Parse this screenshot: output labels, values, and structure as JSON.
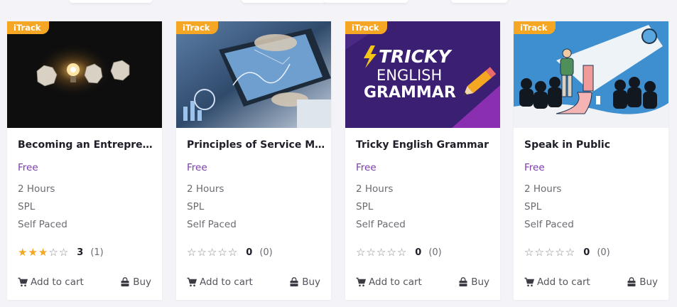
{
  "courses": [
    {
      "badge": "iTrack",
      "title": "Becoming an Entrepreneur",
      "price": "Free",
      "duration": "2 Hours",
      "level": "SPL",
      "pace": "Self Paced",
      "rating": 3,
      "rating_value": "3",
      "rating_count": "(1)",
      "add_to_cart_label": "Add to cart",
      "buy_label": "Buy",
      "thumbnail": "crumpled-paper-lightbulb"
    },
    {
      "badge": "iTrack",
      "title": "Principles of Service Management",
      "price": "Free",
      "duration": "2 Hours",
      "level": "SPL",
      "pace": "Self Paced",
      "rating": 0,
      "rating_value": "0",
      "rating_count": "(0)",
      "add_to_cart_label": "Add to cart",
      "buy_label": "Buy",
      "thumbnail": "tablet-analytics"
    },
    {
      "badge": "iTrack",
      "title": "Tricky English Grammar",
      "price": "Free",
      "duration": "2 Hours",
      "level": "SPL",
      "pace": "Self Paced",
      "rating": 0,
      "rating_value": "0",
      "rating_count": "(0)",
      "add_to_cart_label": "Add to cart",
      "buy_label": "Buy",
      "thumbnail": "tricky-english-grammar",
      "thumbnail_text": [
        "TRICKY",
        "ENGLISH",
        "GRAMMAR"
      ]
    },
    {
      "badge": "iTrack",
      "title": "Speak in Public",
      "price": "Free",
      "duration": "2 Hours",
      "level": "SPL",
      "pace": "Self Paced",
      "rating": 0,
      "rating_value": "0",
      "rating_count": "(0)",
      "add_to_cart_label": "Add to cart",
      "buy_label": "Buy",
      "thumbnail": "public-speaker-audience"
    }
  ],
  "colors": {
    "badge": "#f5a623",
    "price": "#7b3aa8",
    "star_filled": "#f5a623",
    "star_empty": "#8a8a92",
    "page_background": "#f4f3f8"
  },
  "icons": {
    "cart": "cart-icon",
    "buy": "shopping-bag-icon",
    "star": "star-icon"
  }
}
